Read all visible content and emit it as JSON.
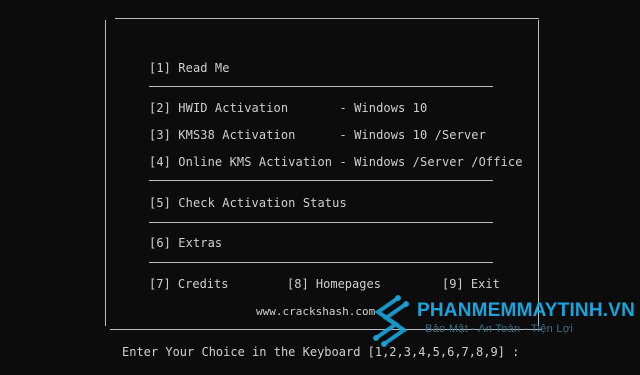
{
  "menu": {
    "read_me": "[1] Read Me",
    "hwid": "[2] HWID Activation       - Windows 10",
    "kms38": "[3] KMS38 Activation      - Windows 10 /Server",
    "online_kms": "[4] Online KMS Activation - Windows /Server /Office",
    "check_status": "[5] Check Activation Status",
    "extras": "[6] Extras",
    "credits": "[7] Credits",
    "homepages": "[8] Homepages",
    "exit": "[9] Exit"
  },
  "website": "www.crackshash.com",
  "prompt": "Enter Your Choice in the Keyboard [1,2,3,4,5,6,7,8,9] :",
  "watermark": {
    "title": "PHANMEMMAYTINH.VN",
    "subtitle": "Bảo Mật - An Toàn - Tiện Lợi",
    "color": "#1aa4dc"
  }
}
